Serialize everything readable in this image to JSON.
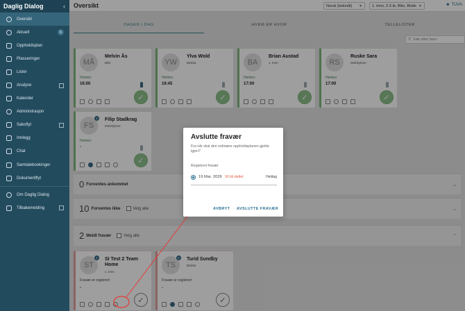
{
  "sidebar": {
    "title": "Daglig Dialog",
    "collapse_icon": "chevron-left-icon",
    "items": [
      {
        "label": "Oversikt",
        "icon": "eye-icon"
      },
      {
        "label": "Aktuelt",
        "icon": "info-icon",
        "badge": "6"
      },
      {
        "label": "Oppholdsplan",
        "icon": "calendar-icon"
      },
      {
        "label": "Plasseringer",
        "icon": "grid-icon"
      },
      {
        "label": "Lister",
        "icon": "list-icon"
      },
      {
        "label": "Analyse",
        "icon": "chart-icon"
      },
      {
        "label": "Kalender",
        "icon": "calendar-icon"
      },
      {
        "label": "Administrasjon",
        "icon": "settings-icon"
      },
      {
        "label": "Saksflyt",
        "icon": "flow-icon"
      },
      {
        "label": "Innlegg",
        "icon": "post-icon"
      },
      {
        "label": "Chat",
        "icon": "chat-icon"
      },
      {
        "label": "Samtalebookinger",
        "icon": "booking-icon"
      },
      {
        "label": "Dokumentflyt",
        "icon": "document-icon"
      },
      {
        "label": "Om Daglig Dialog",
        "icon": "info-icon"
      },
      {
        "label": "Tilbakemelding",
        "icon": "feedback-icon"
      }
    ]
  },
  "topbar": {
    "title": "Oversikt",
    "language": "Norsk (bokmål)",
    "group_filter": "1. trinn, 2-3 år, Blitz, Blokk",
    "user": "TUVA"
  },
  "tabs": [
    "DAGEN I DAG",
    "HVEM ER HVOR",
    "TELLELISTER"
  ],
  "search": {
    "placeholder": "Søk etter barn"
  },
  "cards_present": [
    {
      "initials": "MÅ",
      "name": "Melvin Ås",
      "group": "Blitz",
      "hentes": "Hentes:",
      "time": "16:00"
    },
    {
      "initials": "YW",
      "name": "Ylva Wold",
      "group": "Blokka",
      "hentes": "Hentes:",
      "time": "16:45"
    },
    {
      "initials": "BA",
      "name": "Brian Austad",
      "group": "1. trinn",
      "hentes": "Hentes:",
      "time": "17:00"
    },
    {
      "initials": "RS",
      "name": "Ruske Sara",
      "group": "Molekylene",
      "hentes": "Hentes:",
      "time": "17:00"
    },
    {
      "initials": "FS",
      "name": "Filip Stadkrag",
      "group": "Molekylene",
      "hentes": "Hentes:",
      "time": "-",
      "badge": "1"
    }
  ],
  "sections": [
    {
      "count": "0",
      "label": "Forventes ankommet"
    },
    {
      "count": "10",
      "label": "Forventes ikke",
      "select_all": "Velg alle"
    },
    {
      "count": "2",
      "label": "Meldt fravær",
      "select_all": "Velg alle"
    }
  ],
  "cards_absent": [
    {
      "initials": "ST",
      "name": "SI Test 2 Team Home",
      "group": "1. trinn",
      "status": "Fravær er registrert",
      "time": "-",
      "badge": "1"
    },
    {
      "initials": "TS",
      "name": "Turid Sundby",
      "group": "Blokka",
      "status": "Fravær er registrert",
      "time": "-",
      "badge": "1"
    }
  ],
  "modal": {
    "title": "Avslutte fravær",
    "question": "Fra når skal den ordinære oppholdsplanen gjelde igjen?",
    "field_label": "Registrert fravær",
    "date": "19 Mar. 2026",
    "warning": "Vil bli slettet",
    "duration": "Heldag",
    "cancel": "AVBRYT",
    "confirm": "AVSLUTTE FRAVÆR"
  },
  "colors": {
    "sidebar": "#234b5e",
    "accent": "#2a7090",
    "present": "#7fb67a",
    "absent": "#e0a0a0",
    "annotation": "#e53935"
  }
}
